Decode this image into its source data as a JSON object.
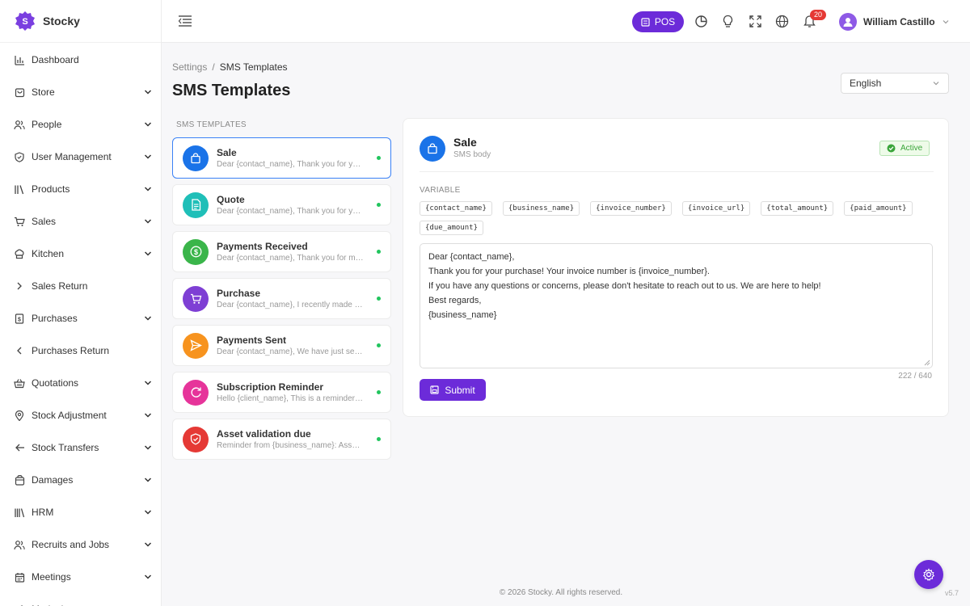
{
  "app": {
    "name": "Stocky",
    "brand_color": "#6c2bd9"
  },
  "sidebar": {
    "items": [
      {
        "label": "Dashboard",
        "icon": "chart-icon",
        "chevron": ""
      },
      {
        "label": "Store",
        "icon": "store-icon",
        "chevron": "down"
      },
      {
        "label": "People",
        "icon": "people-icon",
        "chevron": "down"
      },
      {
        "label": "User Management",
        "icon": "shield-icon",
        "chevron": "down"
      },
      {
        "label": "Products",
        "icon": "products-icon",
        "chevron": "down"
      },
      {
        "label": "Sales",
        "icon": "cart-icon",
        "chevron": "down"
      },
      {
        "label": "Kitchen",
        "icon": "chef-hat-icon",
        "chevron": "down"
      },
      {
        "label": "Sales Return",
        "icon": "chevron-right-icon",
        "chevron": ""
      },
      {
        "label": "Purchases",
        "icon": "receipt-icon",
        "chevron": "down"
      },
      {
        "label": "Purchases Return",
        "icon": "chevron-left-icon",
        "chevron": ""
      },
      {
        "label": "Quotations",
        "icon": "basket-icon",
        "chevron": "down"
      },
      {
        "label": "Stock Adjustment",
        "icon": "location-icon",
        "chevron": "down"
      },
      {
        "label": "Stock Transfers",
        "icon": "arrow-left-icon",
        "chevron": "down"
      },
      {
        "label": "Damages",
        "icon": "bag-icon",
        "chevron": "down"
      },
      {
        "label": "HRM",
        "icon": "library-icon",
        "chevron": "down"
      },
      {
        "label": "Recruits and Jobs",
        "icon": "people-icon",
        "chevron": "down"
      },
      {
        "label": "Meetings",
        "icon": "calendar-icon",
        "chevron": "down"
      },
      {
        "label": "Marketing",
        "icon": "megaphone-icon",
        "chevron": "down"
      }
    ]
  },
  "topbar": {
    "pos_label": "POS",
    "notification_count": "20",
    "user_name": "William Castillo"
  },
  "breadcrumb": {
    "parent": "Settings",
    "separator": "/",
    "current": "SMS Templates"
  },
  "page": {
    "title": "SMS Templates"
  },
  "language": {
    "selected": "English"
  },
  "templates": {
    "heading": "SMS TEMPLATES",
    "items": [
      {
        "name": "Sale",
        "snippet": "Dear {contact_name}, Thank you for your purchase!",
        "color": "#1a73e8",
        "icon": "shopping-bag-icon",
        "active": true
      },
      {
        "name": "Quote",
        "snippet": "Dear {contact_name}, Thank you for your interest",
        "color": "#1fbfb8",
        "icon": "document-icon",
        "active": false
      },
      {
        "name": "Payments Received",
        "snippet": "Dear {contact_name}, Thank you for making your payment",
        "color": "#3ab54a",
        "icon": "dollar-icon",
        "active": false
      },
      {
        "name": "Purchase",
        "snippet": "Dear {contact_name}, I recently made a purchase",
        "color": "#7e3fd4",
        "icon": "cart-icon",
        "active": false
      },
      {
        "name": "Payments Sent",
        "snippet": "Dear {contact_name}, We have just sent our payment",
        "color": "#f7931e",
        "icon": "send-icon",
        "active": false
      },
      {
        "name": "Subscription Reminder",
        "snippet": "Hello {client_name}, This is a reminder for your subscription",
        "color": "#e6349a",
        "icon": "refresh-icon",
        "active": false
      },
      {
        "name": "Asset validation due",
        "snippet": "Reminder from {business_name}: Asset validation due",
        "color": "#e53935",
        "icon": "shield-check-icon",
        "active": false
      }
    ]
  },
  "editor": {
    "title": "Sale",
    "subtitle": "SMS body",
    "status": "Active",
    "variables_label": "VARIABLE",
    "variables": [
      "{contact_name}",
      "{business_name}",
      "{invoice_number}",
      "{invoice_url}",
      "{total_amount}",
      "{paid_amount}",
      "{due_amount}"
    ],
    "body_lines": [
      "Dear {contact_name},",
      "Thank you for your purchase! Your invoice number is {invoice_number}.",
      "If you have any questions or concerns, please don't hesitate to reach out to us. We are here to help!",
      "Best regards,",
      "{business_name}"
    ],
    "char_count": "222 / 640",
    "submit_label": "Submit"
  },
  "footer": {
    "copyright": "© 2026 Stocky. All rights reserved.",
    "version": "v5.7"
  }
}
